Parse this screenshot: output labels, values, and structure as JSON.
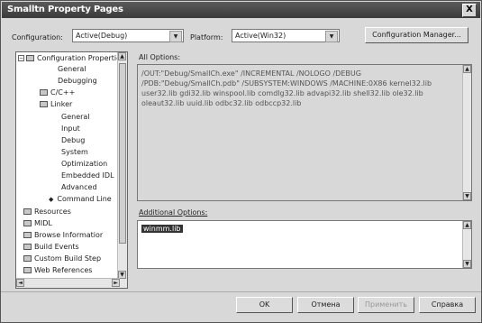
{
  "window": {
    "title": "Smalltn Property Pages",
    "close_label": "X"
  },
  "config": {
    "label": "Configuration:",
    "value": "Active(Debug)"
  },
  "platform": {
    "label": "Platform:",
    "value": "Active(Win32)"
  },
  "config_manager_label": "Configuration Manager...",
  "tree": {
    "items": [
      {
        "label": "Configuration Propertie"
      },
      {
        "label": "General"
      },
      {
        "label": "Debugging"
      },
      {
        "label": "C/C++"
      },
      {
        "label": "Linker"
      },
      {
        "label": "General"
      },
      {
        "label": "Input"
      },
      {
        "label": "Debug"
      },
      {
        "label": "System"
      },
      {
        "label": "Optimization"
      },
      {
        "label": "Embedded IDL"
      },
      {
        "label": "Advanced"
      },
      {
        "label": "Command Line"
      },
      {
        "label": "Resources"
      },
      {
        "label": "MIDL"
      },
      {
        "label": "Browse Informatior"
      },
      {
        "label": "Build Events"
      },
      {
        "label": "Custom Build Step"
      },
      {
        "label": "Web References"
      }
    ]
  },
  "all_options": {
    "label": "All Options:",
    "text": "/OUT:\"Debug/SmallCh.exe\" /INCREMENTAL /NOLOGO /DEBUG /PDB:\"Debug/SmallCh.pdb\" /SUBSYSTEM:WINDOWS /MACHINE:0X86 kernel32.lib user32.lib gdi32.lib winspool.lib comdlg32.lib advapi32.lib shell32.lib ole32.lib oleaut32.lib uuid.lib odbc32.lib odbccp32.lib"
  },
  "additional_options": {
    "label": "Additional Options:",
    "value": "winmm.lib"
  },
  "buttons": {
    "ok": "OK",
    "cancel": "Отмена",
    "apply": "Применить",
    "help": "Справка"
  }
}
